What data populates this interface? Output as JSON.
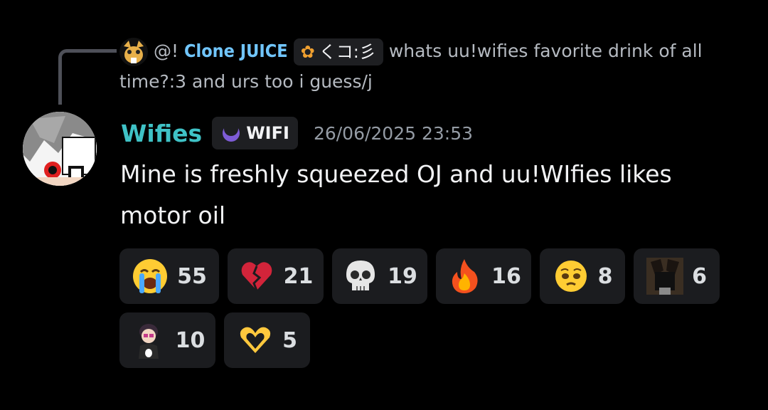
{
  "reply": {
    "mention": "@!",
    "author": "Clone JUICE",
    "tag_label": "くコ:彡",
    "text": "whats uu!wifies favorite drink of all time?:3 and urs too i guess/j"
  },
  "message": {
    "username": "Wifies",
    "role_tag": "WIFI",
    "timestamp": "26/06/2025 23:53",
    "text": "Mine is freshly squeezed OJ and uu!WIfies likes motor oil"
  },
  "reactions": [
    {
      "icon": "loudly-crying-face-icon",
      "count": "55"
    },
    {
      "icon": "broken-heart-icon",
      "count": "21"
    },
    {
      "icon": "skull-icon",
      "count": "19"
    },
    {
      "icon": "fire-icon",
      "count": "16"
    },
    {
      "icon": "pleading-face-icon",
      "count": "8"
    },
    {
      "icon": "custom-cat-emoji-icon",
      "count": "6"
    },
    {
      "icon": "custom-character-emoji-icon",
      "count": "10"
    },
    {
      "icon": "heart-hands-icon",
      "count": "5"
    }
  ],
  "colors": {
    "background": "#000000",
    "username": "#3fc2c6",
    "reply_author": "#71c6ff",
    "reaction_bg": "#1b1c1f"
  }
}
